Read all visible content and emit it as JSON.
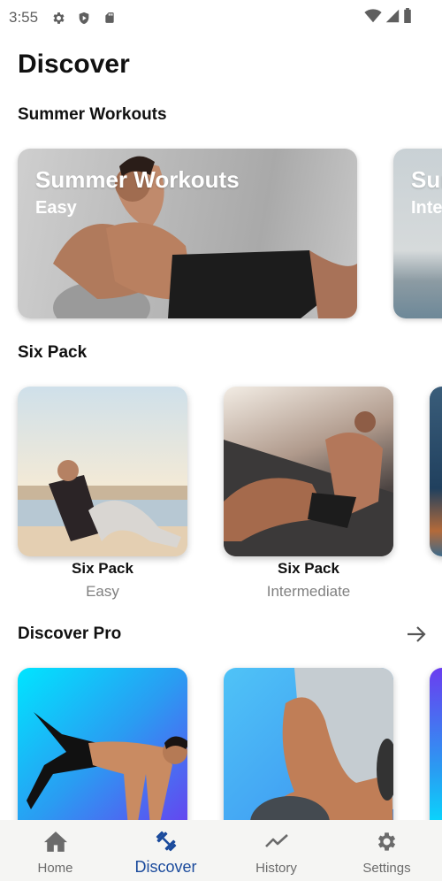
{
  "status_bar": {
    "time": "3:55",
    "left_icons": [
      "gear-icon",
      "shield-play-icon",
      "sd-card-icon"
    ],
    "right_icons": [
      "wifi-icon",
      "signal-icon",
      "battery-icon"
    ]
  },
  "page": {
    "title": "Discover"
  },
  "sections": {
    "summer": {
      "title": "Summer Workouts",
      "banners": [
        {
          "title": "Summer Workouts",
          "subtitle": "Easy"
        },
        {
          "title": "Summer Workouts",
          "subtitle": "Intermediate"
        }
      ]
    },
    "six_pack": {
      "title": "Six Pack",
      "cards": [
        {
          "title": "Six Pack",
          "level": "Easy"
        },
        {
          "title": "Six Pack",
          "level": "Intermediate"
        }
      ]
    },
    "pro": {
      "title": "Discover Pro",
      "more_icon": "arrow-right-icon"
    }
  },
  "bottom_nav": {
    "active": "Discover",
    "active_color": "#1a4a9c",
    "items": [
      {
        "label": "Home",
        "icon": "home-icon"
      },
      {
        "label": "Discover",
        "icon": "dumbbell-icon"
      },
      {
        "label": "History",
        "icon": "trend-icon"
      },
      {
        "label": "Settings",
        "icon": "gear-icon"
      }
    ]
  }
}
